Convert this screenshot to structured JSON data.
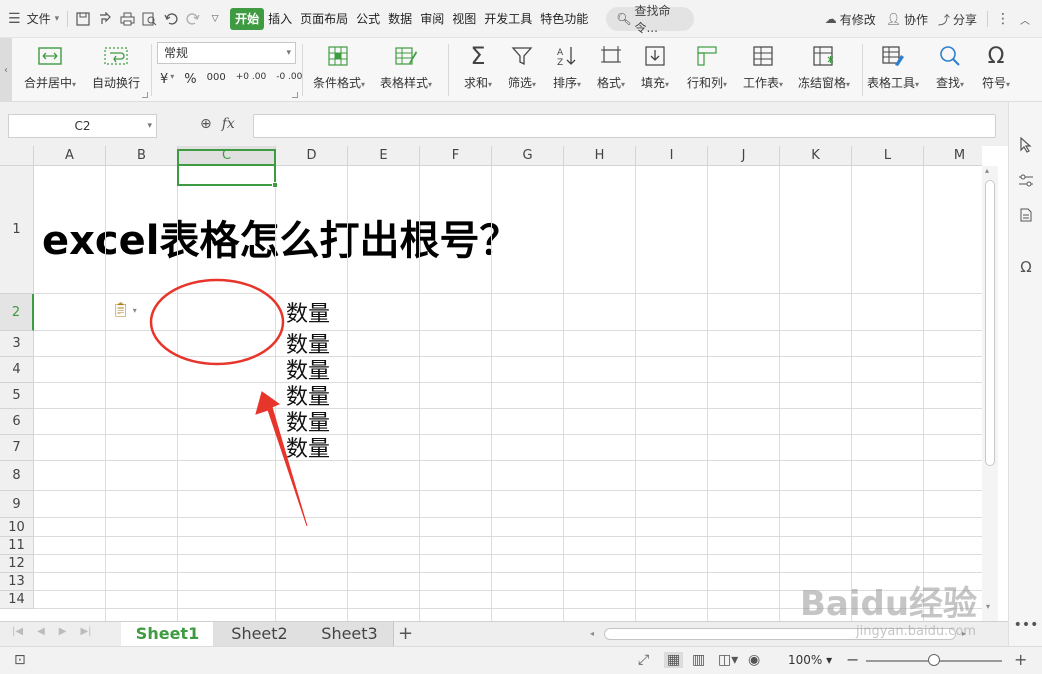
{
  "window": {
    "file_menu": "文件",
    "menu_tabs": [
      "开始",
      "插入",
      "页面布局",
      "公式",
      "数据",
      "审阅",
      "视图",
      "开发工具",
      "特色功能"
    ],
    "search_placeholder": "查找命令...",
    "right_actions": [
      "有修改",
      "协作",
      "分享"
    ]
  },
  "ribbon": {
    "merge_center": "合并居中",
    "wrap_text": "自动换行",
    "number_format": "常规",
    "currency_symbol": "¥",
    "percent_symbol": "%",
    "thousands_symbol": "000",
    "decimal_increase": "+0 .00",
    "decimal_decrease": "-0 .00",
    "conditional_format": "条件格式",
    "table_style": "表格样式",
    "sum": "求和",
    "filter": "筛选",
    "sort": "排序",
    "format": "格式",
    "fill": "填充",
    "row_col": "行和列",
    "worksheet": "工作表",
    "freeze": "冻结窗格",
    "table_tools": "表格工具",
    "find": "查找",
    "symbol": "符号"
  },
  "formula_bar": {
    "name_box": "C2",
    "fx_label": "fx",
    "formula_value": ""
  },
  "grid": {
    "columns": [
      "A",
      "B",
      "C",
      "D",
      "E",
      "F",
      "G",
      "H",
      "I",
      "J",
      "K",
      "L",
      "M"
    ],
    "selected_column": "C",
    "rows": [
      "1",
      "2",
      "3",
      "4",
      "5",
      "6",
      "7",
      "8",
      "9",
      "10",
      "11",
      "12",
      "13",
      "14"
    ],
    "selected_row": "2",
    "title_cell": "excel表格怎么打出根号？",
    "quantity_cells": [
      "数量",
      "数量",
      "数量",
      "数量",
      "数量",
      "数量"
    ]
  },
  "sheets": {
    "tabs": [
      "Sheet1",
      "Sheet2",
      "Sheet3"
    ],
    "active": "Sheet1",
    "add": "+"
  },
  "status": {
    "zoom": "100%",
    "zoom_fraction": 0.5
  },
  "watermark": {
    "brand": "Baidu经验",
    "url": "jingyan.baidu.com"
  },
  "colors": {
    "accent": "#3f9b42",
    "annotation": "#e8352b"
  }
}
